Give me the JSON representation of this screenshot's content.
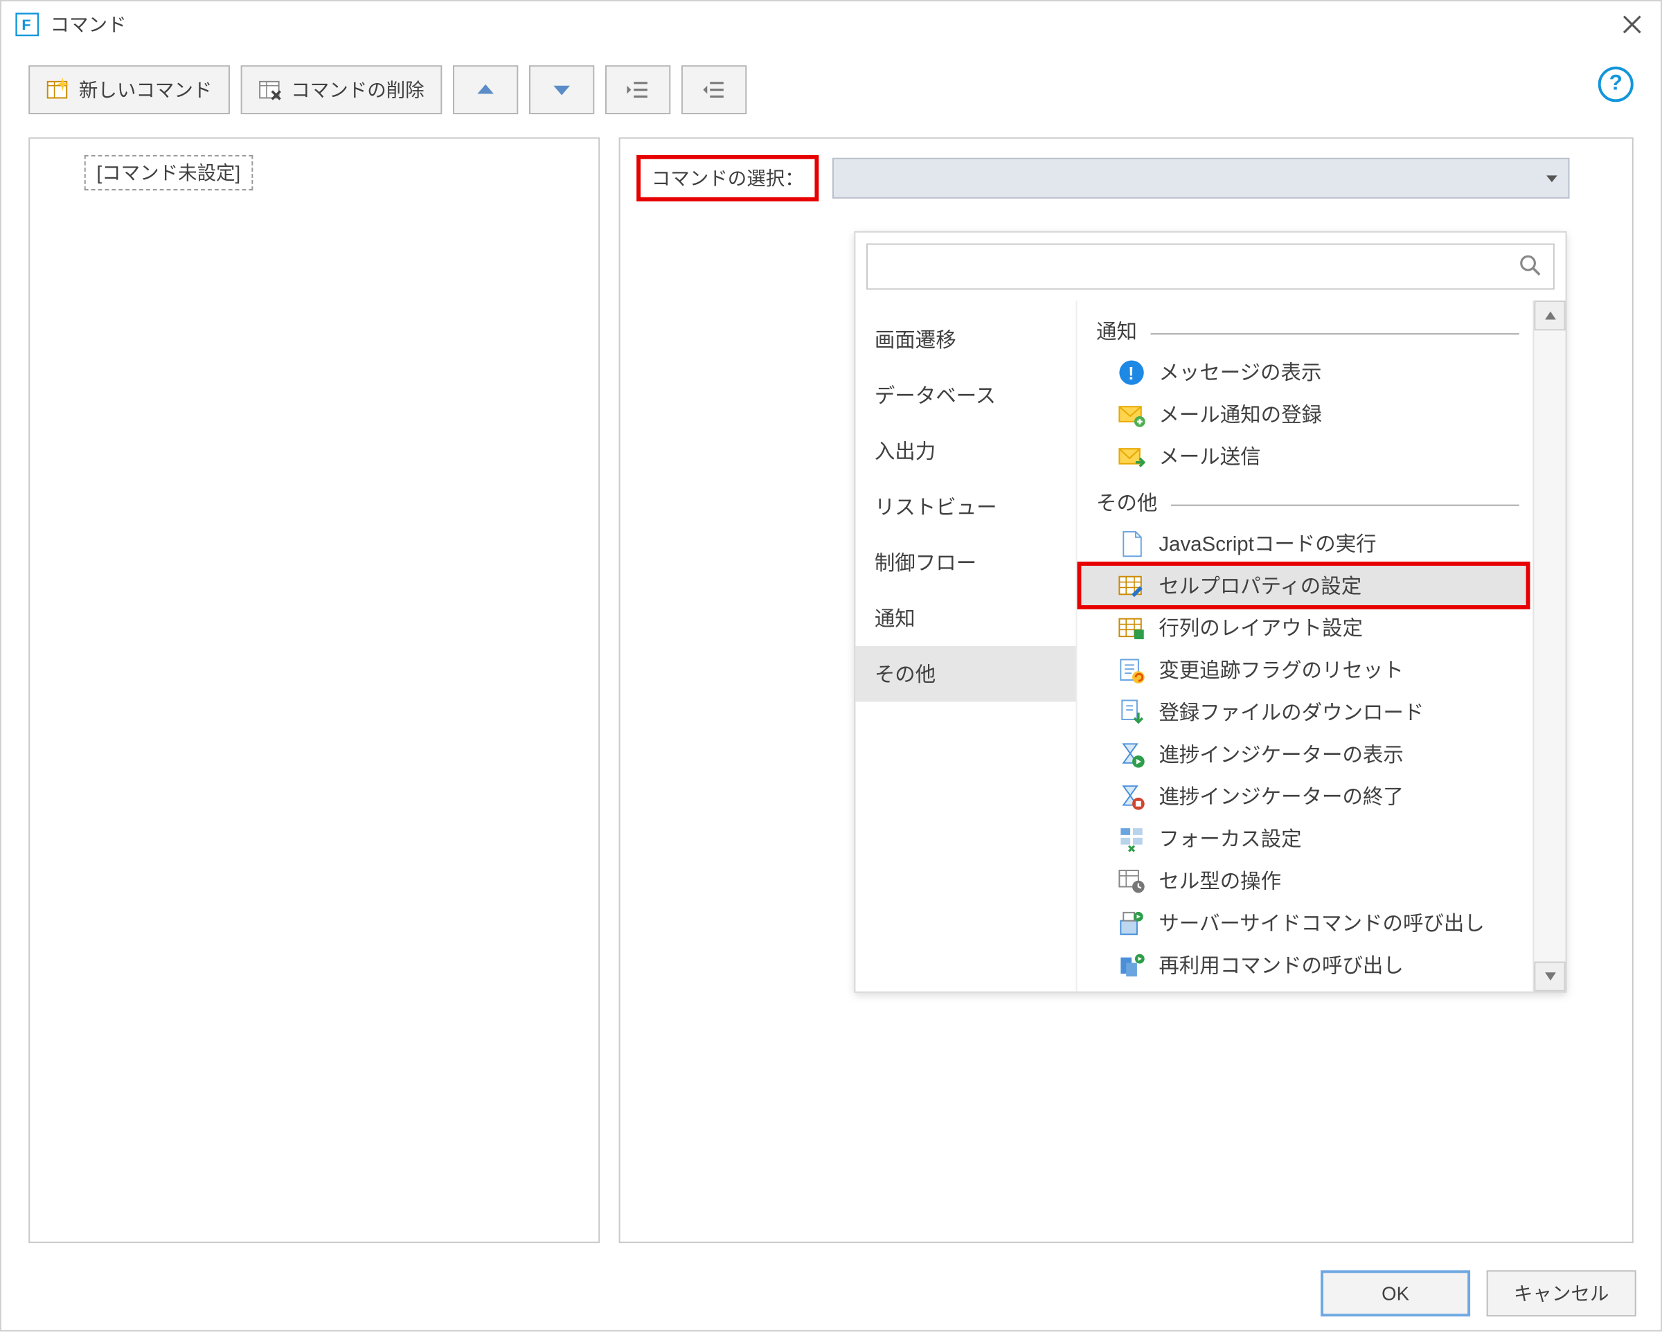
{
  "window": {
    "title": "コマンド"
  },
  "toolbar": {
    "new": "新しいコマンド",
    "delete": "コマンドの削除"
  },
  "left": {
    "placeholder": "[コマンド未設定]"
  },
  "right": {
    "select_label": "コマンドの選択：",
    "search_placeholder": ""
  },
  "categories": [
    "画面遷移",
    "データベース",
    "入出力",
    "リストビュー",
    "制御フロー",
    "通知",
    "その他"
  ],
  "groups": {
    "notification": "通知",
    "other": "その他"
  },
  "commands": {
    "notification": [
      "メッセージの表示",
      "メール通知の登録",
      "メール送信"
    ],
    "other": [
      "JavaScriptコードの実行",
      "セルプロパティの設定",
      "行列のレイアウト設定",
      "変更追跡フラグのリセット",
      "登録ファイルのダウンロード",
      "進捗インジケーターの表示",
      "進捗インジケーターの終了",
      "フォーカス設定",
      "セル型の操作",
      "サーバーサイドコマンドの呼び出し",
      "再利用コマンドの呼び出し"
    ]
  },
  "footer": {
    "ok": "OK",
    "cancel": "キャンセル"
  }
}
